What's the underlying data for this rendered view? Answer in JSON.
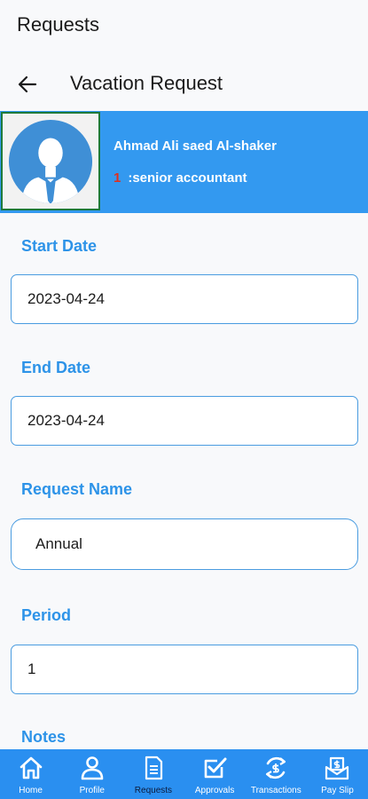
{
  "app": {
    "title": "Requests"
  },
  "appbar": {
    "back_icon": "arrow-left-icon",
    "title": "Vacation Request"
  },
  "employee": {
    "name": "Ahmad Ali saed Al-shaker",
    "id": "1",
    "role": ":senior accountant",
    "avatar_icon": "person-avatar-icon",
    "id_color": "#e0301e",
    "card_color": "#3399f0"
  },
  "form": {
    "start_date": {
      "label": "Start Date",
      "value": "2023-04-24"
    },
    "end_date": {
      "label": "End Date",
      "value": "2023-04-24"
    },
    "request_name": {
      "label": "Request Name",
      "value": "Annual"
    },
    "period": {
      "label": "Period",
      "value": "1"
    },
    "notes": {
      "label": "Notes"
    },
    "label_color": "#2d93e8"
  },
  "bottom_nav": {
    "items": [
      {
        "label": "Home",
        "icon": "home-icon"
      },
      {
        "label": "Profile",
        "icon": "profile-icon"
      },
      {
        "label": "Requests",
        "icon": "document-icon",
        "active": true
      },
      {
        "label": "Approvals",
        "icon": "checkbox-icon"
      },
      {
        "label": "Transactions",
        "icon": "transactions-icon"
      },
      {
        "label": "Pay Slip",
        "icon": "pay-slip-icon"
      }
    ],
    "bg_color": "#2a8ff0"
  }
}
